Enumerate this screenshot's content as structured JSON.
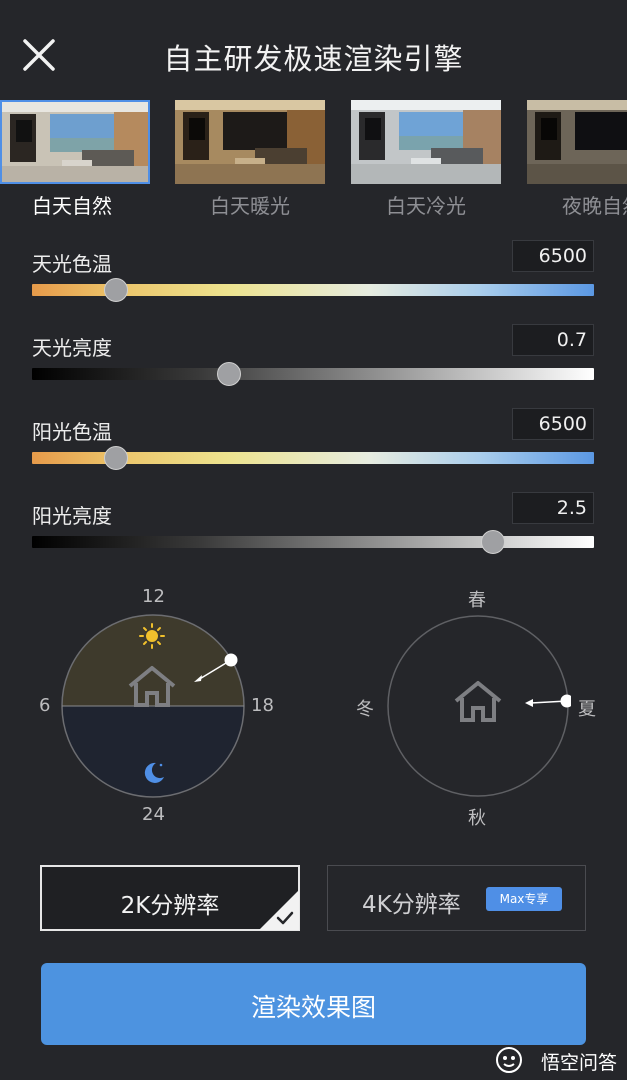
{
  "header": {
    "title": "自主研发极速渲染引擎"
  },
  "presets": [
    {
      "label": "白天自然",
      "selected": true
    },
    {
      "label": "白天暖光",
      "selected": false
    },
    {
      "label": "白天冷光",
      "selected": false
    },
    {
      "label": "夜晚自然",
      "selected": false
    }
  ],
  "sliders": {
    "sky_temp": {
      "label": "天光色温",
      "value": "6500",
      "level": 0.15
    },
    "sky_brightness": {
      "label": "天光亮度",
      "value": "0.7",
      "level": 0.35
    },
    "sun_temp": {
      "label": "阳光色温",
      "value": "6500",
      "level": 0.15
    },
    "sun_brightness": {
      "label": "阳光亮度",
      "value": "2.5",
      "level": 0.82
    }
  },
  "time_dial": {
    "top": "12",
    "left": "6",
    "right": "18",
    "bottom": "24"
  },
  "season_dial": {
    "top": "春",
    "left": "冬",
    "right": "夏",
    "bottom": "秋"
  },
  "resolution": {
    "option_2k": "2K分辨率",
    "option_4k": "4K分辨率",
    "max_badge": "Max专享",
    "selected": "2K"
  },
  "render_button": "渲染效果图",
  "watermark": "悟空问答",
  "colors": {
    "accent": "#4f8fe6",
    "background": "#25262a"
  }
}
